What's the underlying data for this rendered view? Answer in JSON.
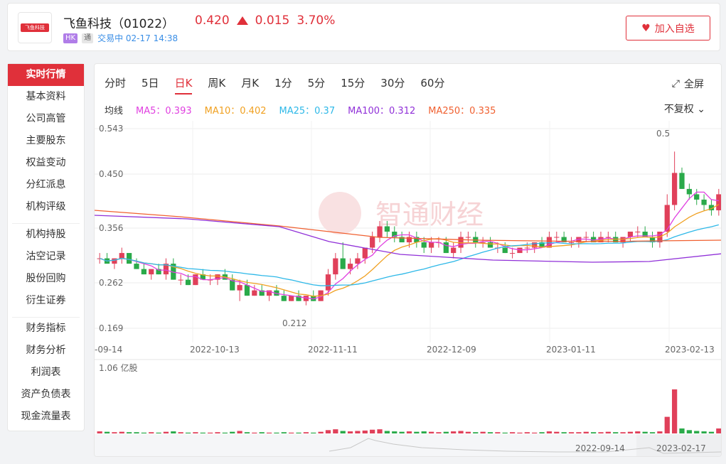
{
  "header": {
    "logo_text": "飞鱼科技",
    "name": "飞鱼科技（01022）",
    "price": "0.420",
    "change": "0.015",
    "change_pct": "3.70%",
    "badge_market": "HK",
    "badge_connect": "通",
    "status": "交易中 02-17 14:38",
    "watch_label": "加入自选"
  },
  "sidebar": {
    "groups": [
      [
        "实时行情",
        "基本资料",
        "公司高管",
        "主要股东",
        "权益变动",
        "分红派息",
        "机构评级"
      ],
      [
        "机构持股",
        "沽空记录",
        "股份回购",
        "衍生证券"
      ],
      [
        "财务指标",
        "财务分析",
        "利润表",
        "资产负债表",
        "现金流量表"
      ]
    ]
  },
  "tabs": [
    "分时",
    "5日",
    "日K",
    "周K",
    "月K",
    "1分",
    "5分",
    "15分",
    "30分",
    "60分"
  ],
  "active_tab": "日K",
  "fullscreen_label": "全屏",
  "ma": {
    "label": "均线",
    "items": [
      {
        "text": "MA5：0.393",
        "color": "#e040e0"
      },
      {
        "text": "MA10：0.402",
        "color": "#f0a020"
      },
      {
        "text": "MA25：0.37",
        "color": "#2db8e8"
      },
      {
        "text": "MA100：0.312",
        "color": "#9030d8"
      },
      {
        "text": "MA250：0.335",
        "color": "#f06030"
      }
    ]
  },
  "adjust_label": "不复权",
  "chart_data": {
    "type": "candlestick",
    "y_ticks": [
      "0.543",
      "0.450",
      "0.356",
      "0.262",
      "0.169"
    ],
    "x_ticks": [
      "-09-14",
      "2022-10-13",
      "2022-11-11",
      "2022-12-09",
      "2023-01-11",
      "2023-02-13"
    ],
    "annotations": {
      "high": "0.5",
      "low": "0.212"
    },
    "volume_label": "1.06 亿股",
    "navigator_dates": [
      "2022-09-14",
      "2023-02-17"
    ],
    "watermark": "智通财经",
    "candles": [
      [
        0.3,
        0.31,
        0.29,
        0.3
      ],
      [
        0.3,
        0.31,
        0.29,
        0.29
      ],
      [
        0.29,
        0.3,
        0.28,
        0.3
      ],
      [
        0.3,
        0.32,
        0.29,
        0.31
      ],
      [
        0.31,
        0.31,
        0.29,
        0.29
      ],
      [
        0.29,
        0.3,
        0.28,
        0.28
      ],
      [
        0.28,
        0.29,
        0.27,
        0.27
      ],
      [
        0.27,
        0.28,
        0.26,
        0.28
      ],
      [
        0.28,
        0.29,
        0.27,
        0.27
      ],
      [
        0.27,
        0.3,
        0.26,
        0.29
      ],
      [
        0.29,
        0.3,
        0.26,
        0.26
      ],
      [
        0.26,
        0.27,
        0.25,
        0.26
      ],
      [
        0.26,
        0.27,
        0.25,
        0.25
      ],
      [
        0.25,
        0.27,
        0.25,
        0.27
      ],
      [
        0.27,
        0.28,
        0.26,
        0.26
      ],
      [
        0.26,
        0.27,
        0.25,
        0.26
      ],
      [
        0.26,
        0.27,
        0.25,
        0.27
      ],
      [
        0.27,
        0.28,
        0.26,
        0.26
      ],
      [
        0.26,
        0.27,
        0.24,
        0.24
      ],
      [
        0.24,
        0.26,
        0.22,
        0.25
      ],
      [
        0.25,
        0.26,
        0.23,
        0.23
      ],
      [
        0.23,
        0.25,
        0.23,
        0.24
      ],
      [
        0.24,
        0.25,
        0.23,
        0.23
      ],
      [
        0.23,
        0.24,
        0.22,
        0.24
      ],
      [
        0.24,
        0.25,
        0.23,
        0.23
      ],
      [
        0.23,
        0.24,
        0.22,
        0.22
      ],
      [
        0.22,
        0.23,
        0.22,
        0.23
      ],
      [
        0.23,
        0.24,
        0.22,
        0.22
      ],
      [
        0.22,
        0.23,
        0.212,
        0.23
      ],
      [
        0.23,
        0.24,
        0.22,
        0.22
      ],
      [
        0.22,
        0.24,
        0.22,
        0.24
      ],
      [
        0.24,
        0.28,
        0.23,
        0.27
      ],
      [
        0.27,
        0.31,
        0.26,
        0.3
      ],
      [
        0.3,
        0.33,
        0.28,
        0.28
      ],
      [
        0.28,
        0.3,
        0.27,
        0.29
      ],
      [
        0.29,
        0.31,
        0.28,
        0.3
      ],
      [
        0.3,
        0.32,
        0.29,
        0.32
      ],
      [
        0.32,
        0.35,
        0.31,
        0.34
      ],
      [
        0.34,
        0.37,
        0.33,
        0.36
      ],
      [
        0.36,
        0.37,
        0.34,
        0.35
      ],
      [
        0.35,
        0.36,
        0.33,
        0.34
      ],
      [
        0.34,
        0.35,
        0.33,
        0.33
      ],
      [
        0.33,
        0.35,
        0.32,
        0.34
      ],
      [
        0.34,
        0.35,
        0.32,
        0.33
      ],
      [
        0.33,
        0.34,
        0.31,
        0.32
      ],
      [
        0.32,
        0.34,
        0.31,
        0.33
      ],
      [
        0.33,
        0.34,
        0.32,
        0.33
      ],
      [
        0.33,
        0.34,
        0.31,
        0.31
      ],
      [
        0.31,
        0.33,
        0.3,
        0.32
      ],
      [
        0.32,
        0.35,
        0.31,
        0.34
      ],
      [
        0.34,
        0.35,
        0.33,
        0.34
      ],
      [
        0.34,
        0.35,
        0.32,
        0.33
      ],
      [
        0.33,
        0.34,
        0.32,
        0.33
      ],
      [
        0.33,
        0.34,
        0.32,
        0.32
      ],
      [
        0.32,
        0.33,
        0.31,
        0.32
      ],
      [
        0.32,
        0.33,
        0.31,
        0.31
      ],
      [
        0.31,
        0.32,
        0.3,
        0.31
      ],
      [
        0.31,
        0.32,
        0.31,
        0.32
      ],
      [
        0.32,
        0.33,
        0.31,
        0.32
      ],
      [
        0.32,
        0.33,
        0.31,
        0.33
      ],
      [
        0.33,
        0.34,
        0.32,
        0.32
      ],
      [
        0.32,
        0.35,
        0.32,
        0.34
      ],
      [
        0.34,
        0.35,
        0.33,
        0.34
      ],
      [
        0.34,
        0.35,
        0.33,
        0.33
      ],
      [
        0.33,
        0.34,
        0.32,
        0.33
      ],
      [
        0.33,
        0.34,
        0.32,
        0.34
      ],
      [
        0.34,
        0.35,
        0.33,
        0.34
      ],
      [
        0.34,
        0.35,
        0.33,
        0.33
      ],
      [
        0.33,
        0.35,
        0.33,
        0.34
      ],
      [
        0.34,
        0.35,
        0.33,
        0.34
      ],
      [
        0.34,
        0.35,
        0.33,
        0.33
      ],
      [
        0.33,
        0.34,
        0.32,
        0.34
      ],
      [
        0.34,
        0.35,
        0.33,
        0.35
      ],
      [
        0.35,
        0.36,
        0.34,
        0.35
      ],
      [
        0.35,
        0.36,
        0.34,
        0.34
      ],
      [
        0.34,
        0.35,
        0.32,
        0.33
      ],
      [
        0.33,
        0.35,
        0.32,
        0.35
      ],
      [
        0.35,
        0.42,
        0.34,
        0.4
      ],
      [
        0.4,
        0.5,
        0.39,
        0.46
      ],
      [
        0.46,
        0.47,
        0.43,
        0.43
      ],
      [
        0.43,
        0.44,
        0.41,
        0.42
      ],
      [
        0.42,
        0.43,
        0.4,
        0.41
      ],
      [
        0.41,
        0.42,
        0.39,
        0.4
      ],
      [
        0.4,
        0.41,
        0.38,
        0.39
      ],
      [
        0.39,
        0.43,
        0.38,
        0.42
      ]
    ],
    "volume": [
      0.05,
      0.04,
      0.03,
      0.04,
      0.03,
      0.03,
      0.02,
      0.03,
      0.02,
      0.04,
      0.05,
      0.03,
      0.02,
      0.03,
      0.02,
      0.02,
      0.03,
      0.02,
      0.04,
      0.06,
      0.03,
      0.02,
      0.03,
      0.02,
      0.02,
      0.03,
      0.02,
      0.02,
      0.03,
      0.02,
      0.04,
      0.08,
      0.1,
      0.06,
      0.05,
      0.06,
      0.07,
      0.09,
      0.1,
      0.06,
      0.05,
      0.04,
      0.05,
      0.04,
      0.05,
      0.04,
      0.03,
      0.04,
      0.05,
      0.06,
      0.04,
      0.03,
      0.04,
      0.03,
      0.03,
      0.02,
      0.03,
      0.02,
      0.03,
      0.02,
      0.03,
      0.05,
      0.04,
      0.03,
      0.03,
      0.03,
      0.04,
      0.03,
      0.03,
      0.04,
      0.03,
      0.03,
      0.04,
      0.05,
      0.04,
      0.03,
      0.05,
      0.4,
      1.06,
      0.12,
      0.08,
      0.06,
      0.05,
      0.04,
      0.12
    ]
  }
}
